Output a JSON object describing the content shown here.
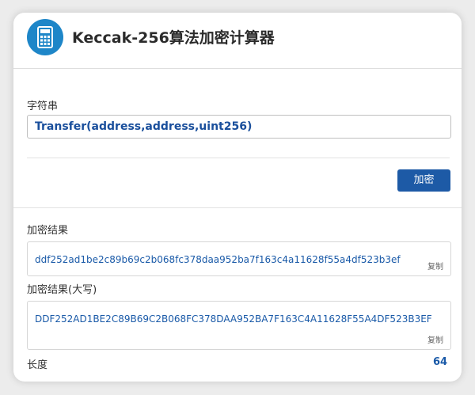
{
  "header": {
    "title": "Keccak-256算法加密计算器",
    "icon": "calculator-icon"
  },
  "input": {
    "label": "字符串",
    "value": "Transfer(address,address,uint256)"
  },
  "encrypt_button": {
    "label": "加密"
  },
  "result": {
    "label": "加密结果",
    "value": "ddf252ad1be2c89b69c2b068fc378daa952ba7f163c4a11628f55a4df523b3ef",
    "copy_label": "复制"
  },
  "result_upper": {
    "label": "加密结果(大写)",
    "value": "DDF252AD1BE2C89B69C2B068FC378DAA952BA7F163C4A11628F55A4DF523B3EF",
    "copy_label": "复制"
  },
  "length": {
    "label": "长度",
    "value": "64"
  },
  "colors": {
    "accent": "#1d5aa6",
    "icon_bg": "#1e86c8",
    "value_text": "#1a5aa8"
  }
}
